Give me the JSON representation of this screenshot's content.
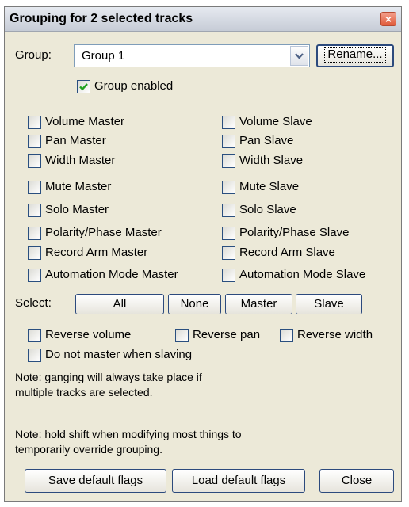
{
  "window": {
    "title": "Grouping for 2 selected tracks",
    "close_symbol": "×"
  },
  "group": {
    "label": "Group:",
    "selected": "Group 1",
    "rename_label": "Rename...",
    "enabled_label": "Group enabled",
    "enabled": true
  },
  "flags_left": [
    {
      "label": "Volume Master",
      "checked": false
    },
    {
      "label": "Pan Master",
      "checked": false
    },
    {
      "label": "Width Master",
      "checked": false
    },
    {
      "label": "Mute Master",
      "checked": false
    },
    {
      "label": "Solo Master",
      "checked": false
    },
    {
      "label": "Polarity/Phase Master",
      "checked": false
    },
    {
      "label": "Record Arm Master",
      "checked": false
    },
    {
      "label": "Automation Mode Master",
      "checked": false
    }
  ],
  "flags_right": [
    {
      "label": "Volume Slave",
      "checked": false
    },
    {
      "label": "Pan Slave",
      "checked": false
    },
    {
      "label": "Width Slave",
      "checked": false
    },
    {
      "label": "Mute Slave",
      "checked": false
    },
    {
      "label": "Solo Slave",
      "checked": false
    },
    {
      "label": "Polarity/Phase Slave",
      "checked": false
    },
    {
      "label": "Record Arm Slave",
      "checked": false
    },
    {
      "label": "Automation Mode Slave",
      "checked": false
    }
  ],
  "select": {
    "label": "Select:",
    "all": "All",
    "none": "None",
    "master": "Master",
    "slave": "Slave"
  },
  "options": {
    "reverse_volume": "Reverse volume",
    "reverse_pan": "Reverse pan",
    "reverse_width": "Reverse width",
    "do_not_master": "Do not master when slaving"
  },
  "notes": {
    "note1_line1": "Note: ganging will always take place if",
    "note1_line2": "multiple tracks are selected.",
    "note2_line1": "Note: hold shift when modifying most things to",
    "note2_line2": "temporarily override grouping."
  },
  "footer": {
    "save": "Save default flags",
    "load": "Load default flags",
    "close": "Close"
  },
  "colors": {
    "dialog_bg": "#ece9d8",
    "button_border": "#2c4a7d",
    "close_red": "#e05a3a"
  }
}
